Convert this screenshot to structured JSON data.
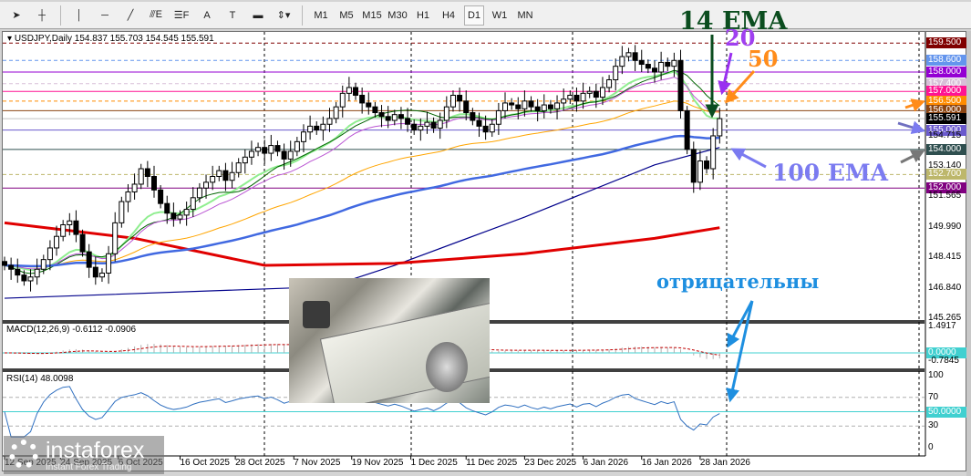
{
  "toolbar": {
    "tools": [
      {
        "name": "cursor-icon",
        "glyph": "➤"
      },
      {
        "name": "crosshair-icon",
        "glyph": "┼"
      },
      {
        "name": "vertical-line-icon",
        "glyph": "│"
      },
      {
        "name": "horizontal-line-icon",
        "glyph": "─"
      },
      {
        "name": "trendline-icon",
        "glyph": "╱"
      },
      {
        "name": "fibonacci-icon",
        "glyph": "⫻E"
      },
      {
        "name": "fibo-channel-icon",
        "glyph": "☰F"
      },
      {
        "name": "text-icon",
        "glyph": "A"
      },
      {
        "name": "text-label-icon",
        "glyph": "T"
      },
      {
        "name": "rectangle-icon",
        "glyph": "▬"
      },
      {
        "name": "arrows-dropdown-icon",
        "glyph": "⇕▾"
      }
    ],
    "timeframes": [
      "M1",
      "M5",
      "M15",
      "M30",
      "H1",
      "H4",
      "D1",
      "W1",
      "MN"
    ],
    "active_timeframe": "D1"
  },
  "chart_info": {
    "symbol_line": "USDJPY,Daily  154.837 155.703 154.545 155.591"
  },
  "macd_info": "MACD(12,26,9) -0.6112 -0.0906",
  "rsi_info": "RSI(14) 48.0098",
  "annotations": {
    "ema14": "14 EMA",
    "ema20": "20",
    "ema50": "50",
    "ema100": "100 EMA",
    "negative": "отрицательны"
  },
  "logo": {
    "name": "instaforex",
    "tagline": "Instant Forex Trading"
  },
  "price_axis": {
    "levels": [
      {
        "value": "159.500",
        "price": 159.5,
        "color": "#800000",
        "style": "dash"
      },
      {
        "value": "158.600",
        "price": 158.6,
        "color": "#6495ED",
        "style": "dash"
      },
      {
        "value": "158.000",
        "price": 158.0,
        "color": "#9400D3",
        "style": "solid"
      },
      {
        "value": "157.400",
        "price": 157.4,
        "color": "#D8BFD8",
        "style": "dash"
      },
      {
        "value": "157.000",
        "price": 157.0,
        "color": "#FF1493",
        "style": "solid"
      },
      {
        "value": "156.500",
        "price": 156.5,
        "color": "#FF8C00",
        "style": "dash"
      },
      {
        "value": "156.000",
        "price": 156.0,
        "color": "#8B4513",
        "style": "solid"
      },
      {
        "value": "155.591",
        "price": 155.591,
        "color": "#000000",
        "style": "solid"
      },
      {
        "value": "155.000",
        "price": 155.0,
        "color": "#6A5ACD",
        "style": "solid"
      },
      {
        "value": "154.000",
        "price": 154.0,
        "color": "#2F4F4F",
        "style": "solid"
      },
      {
        "value": "152.700",
        "price": 152.7,
        "color": "#BDB76B",
        "style": "dash"
      },
      {
        "value": "152.000",
        "price": 152.0,
        "color": "#800080",
        "style": "solid"
      }
    ],
    "ticks": [
      "154.715",
      "153.140",
      "151.565",
      "149.990",
      "148.415",
      "146.840",
      "145.265"
    ]
  },
  "macd_axis": {
    "top": "1.4917",
    "zero": "0.0000",
    "bottom": "-0.7845"
  },
  "rsi_axis": {
    "ticks": [
      "100",
      "70",
      "50.0000",
      "30",
      "0"
    ]
  },
  "chart_data": {
    "type": "candlestick",
    "title": "USDJPY,Daily",
    "ylim": [
      145.265,
      159.6
    ],
    "closes": [
      148.0,
      147.8,
      147.5,
      147.2,
      147.4,
      147.8,
      148.3,
      148.9,
      149.5,
      150.1,
      150.3,
      149.6,
      148.7,
      147.9,
      147.4,
      147.6,
      148.6,
      150.2,
      151.3,
      151.8,
      152.2,
      153.0,
      152.6,
      151.9,
      151.2,
      150.7,
      150.4,
      150.6,
      150.9,
      151.5,
      152.0,
      152.3,
      152.6,
      152.9,
      152.4,
      152.8,
      153.3,
      153.6,
      153.9,
      154.1,
      153.8,
      154.2,
      153.9,
      153.5,
      153.9,
      154.4,
      154.9,
      155.2,
      155.0,
      155.3,
      155.6,
      156.2,
      156.9,
      157.2,
      156.8,
      156.4,
      156.2,
      155.9,
      155.7,
      155.5,
      155.8,
      155.6,
      155.3,
      155.0,
      155.2,
      155.4,
      155.1,
      155.5,
      156.2,
      156.8,
      156.5,
      155.9,
      155.5,
      155.2,
      154.9,
      155.3,
      156.0,
      156.4,
      156.3,
      156.1,
      156.5,
      156.2,
      156.0,
      156.3,
      156.1,
      156.4,
      156.6,
      156.8,
      156.5,
      156.9,
      157.0,
      156.7,
      157.2,
      157.6,
      158.3,
      158.8,
      159.0,
      158.6,
      158.4,
      158.2,
      158.0,
      158.5,
      158.3,
      158.6,
      156.0,
      154.0,
      152.3,
      153.4,
      153.0,
      154.7,
      155.591
    ],
    "first_open": 148.2,
    "x_labels": [
      {
        "label": "12 Sep 2025",
        "index": 0
      },
      {
        "label": "24 Sep 2025",
        "index": 8.6
      },
      {
        "label": "6 Oct 2025",
        "index": 17.5
      },
      {
        "label": "16 Oct 2025",
        "index": 27
      },
      {
        "label": "28 Oct 2025",
        "index": 35.5
      },
      {
        "label": "7 Nov 2025",
        "index": 44.5
      },
      {
        "label": "19 Nov 2025",
        "index": 53.4
      },
      {
        "label": "1 Dec 2025",
        "index": 62.5
      },
      {
        "label": "11 Dec 2025",
        "index": 71
      },
      {
        "label": "23 Dec 2025",
        "index": 80
      },
      {
        "label": "6 Jan 2026",
        "index": 89
      },
      {
        "label": "16 Jan 2026",
        "index": 98
      },
      {
        "label": "28 Jan 2026",
        "index": 107
      }
    ],
    "moving_averages": [
      {
        "name": "EMA 14",
        "period": 14,
        "kind": "ema",
        "color": "#90EE90"
      },
      {
        "name": "SMA 14",
        "period": 14,
        "kind": "sma",
        "color": "#006400"
      },
      {
        "name": "EMA 20",
        "period": 20,
        "kind": "ema",
        "color": "#BA55D3"
      },
      {
        "name": "EMA 50",
        "period": 50,
        "kind": "ema",
        "color": "#FFA500"
      },
      {
        "name": "EMA 100",
        "period": 100,
        "kind": "ema",
        "color": "#4169E1"
      }
    ],
    "extra_series": [
      {
        "name": "MA navy",
        "color": "#00008B",
        "points": [
          [
            0,
            146.3
          ],
          [
            50,
            146.9
          ],
          [
            60,
            148.0
          ],
          [
            80,
            150.5
          ],
          [
            100,
            153.2
          ],
          [
            110,
            154.1
          ]
        ]
      },
      {
        "name": "MA 200",
        "color": "#E00000",
        "points": [
          [
            0,
            150.2
          ],
          [
            20,
            149.4
          ],
          [
            40,
            148.0
          ],
          [
            60,
            148.1
          ],
          [
            80,
            148.6
          ],
          [
            100,
            149.4
          ],
          [
            110,
            149.95
          ]
        ]
      }
    ],
    "macd": {
      "fast": 12,
      "slow": 26,
      "signal": 9,
      "ylim": [
        -0.7845,
        1.4917
      ]
    },
    "rsi": {
      "period": 14,
      "levels": [
        70,
        50,
        30
      ],
      "ylim": [
        0,
        100
      ]
    }
  }
}
